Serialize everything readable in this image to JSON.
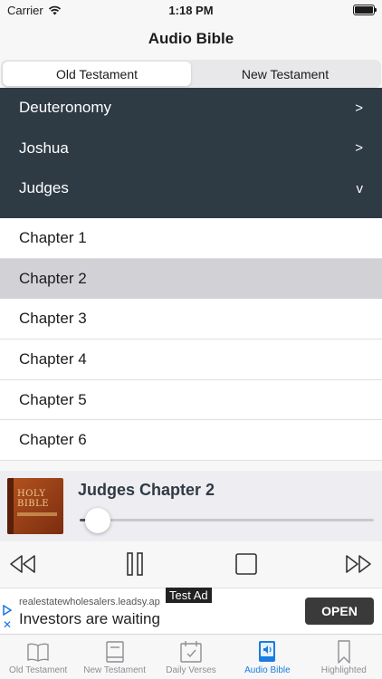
{
  "status_bar": {
    "carrier": "Carrier",
    "time": "1:18 PM"
  },
  "nav": {
    "title": "Audio Bible"
  },
  "segments": [
    {
      "label": "Old Testament",
      "active": true
    },
    {
      "label": "New Testament",
      "active": false
    }
  ],
  "books": [
    {
      "name": "Deuteronomy",
      "indicator": ">"
    },
    {
      "name": "Joshua",
      "indicator": ">"
    },
    {
      "name": "Judges",
      "indicator": "v"
    }
  ],
  "chapters": [
    "Chapter 1",
    "Chapter 2",
    "Chapter 3",
    "Chapter 4",
    "Chapter 5",
    "Chapter 6"
  ],
  "selected_chapter": "Chapter 2",
  "player": {
    "title": "Judges Chapter 2",
    "cover_text": "HOLY BIBLE",
    "progress": 0.02
  },
  "controls": [
    "rewind-icon",
    "pause-icon",
    "stop-icon",
    "fast-forward-icon"
  ],
  "ad": {
    "badge": "Test Ad",
    "url": "realestatewholesalers.leadsy.ap",
    "headline": "Investors are waiting",
    "cta": "OPEN"
  },
  "tabs": [
    {
      "label": "Old Testament",
      "icon": "open-book-icon",
      "active": false
    },
    {
      "label": "New Testament",
      "icon": "book-icon",
      "active": false
    },
    {
      "label": "Daily Verses",
      "icon": "calendar-check-icon",
      "active": false
    },
    {
      "label": "Audio Bible",
      "icon": "audio-book-icon",
      "active": true
    },
    {
      "label": "Highlighted",
      "icon": "bookmark-icon",
      "active": false
    }
  ],
  "colors": {
    "accent": "#1a7de0",
    "book_list_bg": "#2e3a44",
    "selected_row": "#d1d1d6"
  }
}
